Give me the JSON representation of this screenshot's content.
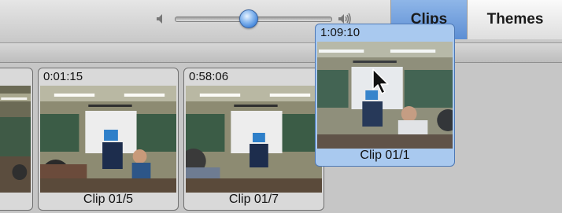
{
  "tabs": [
    {
      "label": "Clips",
      "active": true
    },
    {
      "label": "Themes",
      "active": false
    }
  ],
  "volume": {
    "level": 0.45
  },
  "clips": [
    {
      "time": "",
      "name": ""
    },
    {
      "time": "0:01:15",
      "name": "Clip 01/5"
    },
    {
      "time": "0:58:06",
      "name": "Clip 01/7"
    }
  ],
  "dragged_clip": {
    "time": "1:09:10",
    "name": "Clip 01/1"
  },
  "icons": {
    "volume_low": "speaker-low-icon",
    "volume_high": "speaker-high-icon",
    "cursor": "arrow-cursor-icon"
  },
  "colors": {
    "accent": "#5c8ed4",
    "selection": "#a9c9ef"
  }
}
